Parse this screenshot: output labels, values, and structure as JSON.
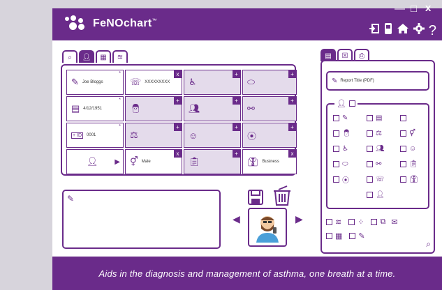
{
  "app": {
    "title": "FeNOchart",
    "trademark": "™"
  },
  "window_controls": {
    "minimize": "—",
    "maximize": "□",
    "close": "x"
  },
  "toolbar_icons": [
    "exit-icon",
    "device-icon",
    "home-icon",
    "gear-icon",
    "help-icon"
  ],
  "toolbar_help": "?",
  "left_tabs": [
    "search",
    "patient",
    "table",
    "chart"
  ],
  "grid": {
    "row1": {
      "name": "Joe Bloggs",
      "phone": "XXXXXXXXX"
    },
    "row2": {
      "dob": "4/12/1951"
    },
    "row3": {
      "id_label": "+ ID",
      "id_value": "0001"
    },
    "row4": {
      "gender": "Male",
      "occupation": "Business"
    }
  },
  "right_tabs": [
    "pdf",
    "excel",
    "print"
  ],
  "report": {
    "title": "Report Title (PDF)"
  },
  "footer": {
    "tagline": "Aids in the diagnosis and management of asthma, one breath at a time."
  }
}
